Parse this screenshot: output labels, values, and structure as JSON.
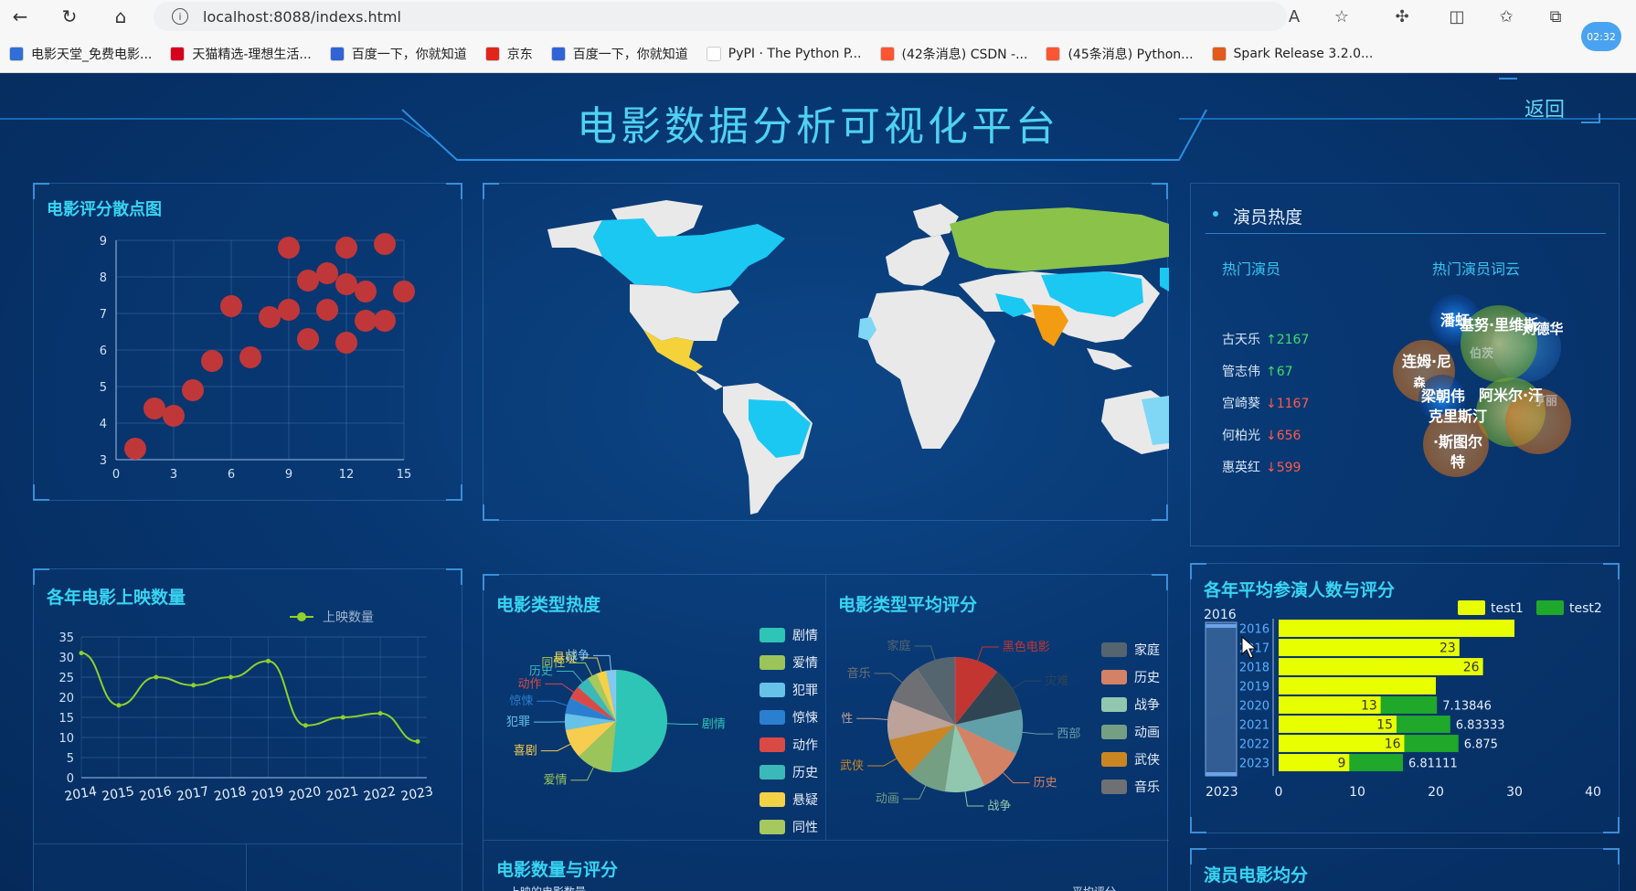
{
  "browser": {
    "url": "localhost:8088/indexs.html",
    "clock": "02:32",
    "bookmarks": [
      {
        "label": "电影天堂_免费电影...",
        "color": "#2f6fd6"
      },
      {
        "label": "天猫精选-理想生活...",
        "color": "#d6001c"
      },
      {
        "label": "百度一下，你就知道",
        "color": "#3064d6"
      },
      {
        "label": "京东",
        "color": "#e1251b"
      },
      {
        "label": "百度一下，你就知道",
        "color": "#3064d6"
      },
      {
        "label": "PyPI · The Python P...",
        "color": "#ffffff"
      },
      {
        "label": "(42条消息) CSDN -...",
        "color": "#fc5531"
      },
      {
        "label": "(45条消息) Python...",
        "color": "#fc5531"
      },
      {
        "label": "Spark Release 3.2.0...",
        "color": "#e25a1c"
      }
    ]
  },
  "header": {
    "title": "电影数据分析可视化平台",
    "back": "返回"
  },
  "scatter": {
    "title": "电影评分散点图",
    "chart_data": {
      "type": "scatter",
      "xlim": [
        0,
        15
      ],
      "ylim": [
        3,
        9
      ],
      "xticks": [
        "0",
        "3",
        "6",
        "9",
        "12",
        "15"
      ],
      "yticks": [
        "3",
        "4",
        "5",
        "6",
        "7",
        "8",
        "9"
      ],
      "points": [
        [
          1,
          3.3
        ],
        [
          2,
          4.4
        ],
        [
          3,
          4.2
        ],
        [
          4,
          4.9
        ],
        [
          5,
          5.7
        ],
        [
          6,
          7.2
        ],
        [
          7,
          5.8
        ],
        [
          8,
          6.9
        ],
        [
          9,
          8.8
        ],
        [
          9,
          7.1
        ],
        [
          10,
          7.9
        ],
        [
          10,
          6.3
        ],
        [
          11,
          8.1
        ],
        [
          11,
          7.1
        ],
        [
          12,
          8.8
        ],
        [
          12,
          7.8
        ],
        [
          12,
          6.2
        ],
        [
          13,
          7.6
        ],
        [
          13,
          6.8
        ],
        [
          14,
          6.8
        ],
        [
          14,
          8.9
        ],
        [
          15,
          7.6
        ]
      ],
      "color": "#c0373a"
    }
  },
  "map": {
    "colors": {
      "ocean": "#06386f",
      "land": "#e9e9e9",
      "cyan": "#1bc8f2",
      "green": "#8bc34a",
      "orange": "#f39c12",
      "yellow": "#f5d23a",
      "light": "#7fd7f5"
    }
  },
  "actors": {
    "title": "演员热度",
    "hot_title": "热门演员",
    "cloud_title": "热门演员词云",
    "list": [
      {
        "name": "古天乐",
        "trend": "↑2167",
        "dir": "up"
      },
      {
        "name": "管志伟",
        "trend": "↑67",
        "dir": "up"
      },
      {
        "name": "宫崎葵",
        "trend": "↓1167",
        "dir": "down"
      },
      {
        "name": "何柏光",
        "trend": "↓656",
        "dir": "down"
      },
      {
        "name": "惠英红",
        "trend": "↓599",
        "dir": "down"
      }
    ],
    "cloud_words": [
      "潘虹",
      "基努·里维斯",
      "刘德华",
      "连姆·尼",
      "森",
      "梁朝伟",
      "阿米尔·汗",
      "克里斯汀",
      "·斯图尔",
      "特",
      "伯茨",
      "亨丽"
    ]
  },
  "yearly": {
    "title": "各年电影上映数量",
    "legend": "上映数量",
    "chart_data": {
      "type": "line",
      "categories": [
        "2014",
        "2015",
        "2016",
        "2017",
        "2018",
        "2019",
        "2020",
        "2021",
        "2022",
        "2023"
      ],
      "series": [
        {
          "name": "上映数量",
          "values": [
            31,
            18,
            25,
            23,
            25,
            29,
            13,
            15,
            16,
            9
          ]
        }
      ],
      "ylim": [
        0,
        35
      ],
      "yticks": [
        "0",
        "5",
        "10",
        "15",
        "20",
        "25",
        "30",
        "35"
      ],
      "color": "#8fd12a"
    }
  },
  "genre_heat": {
    "title": "电影类型热度",
    "chart_data": {
      "type": "pie",
      "slices": [
        {
          "name": "剧情",
          "value": 50,
          "color": "#2ec4b6"
        },
        {
          "name": "爱情",
          "value": 11,
          "color": "#9bc45a"
        },
        {
          "name": "喜剧",
          "value": 9,
          "color": "#f6cd4e"
        },
        {
          "name": "犯罪",
          "value": 5,
          "color": "#66c2e8"
        },
        {
          "name": "惊悚",
          "value": 5,
          "color": "#2b7fd0"
        },
        {
          "name": "动作",
          "value": 4,
          "color": "#d94a45"
        },
        {
          "name": "历史",
          "value": 4,
          "color": "#3bb8b8"
        },
        {
          "name": "同性",
          "value": 3,
          "color": "#a6c85e"
        },
        {
          "name": "悬疑",
          "value": 3,
          "color": "#f4d248"
        },
        {
          "name": "战争",
          "value": 3,
          "color": "#84c7f0"
        }
      ],
      "legend": [
        "剧情",
        "爱情",
        "犯罪",
        "惊悚",
        "动作",
        "历史",
        "悬疑",
        "同性"
      ]
    }
  },
  "genre_score": {
    "title": "电影类型平均评分",
    "chart_data": {
      "type": "pie",
      "slices": [
        {
          "name": "黑色电影",
          "value": 9,
          "color": "#c23531"
        },
        {
          "name": "灾难",
          "value": 9,
          "color": "#2f4554"
        },
        {
          "name": "西部",
          "value": 9,
          "color": "#61a0a8"
        },
        {
          "name": "历史",
          "value": 9,
          "color": "#d48265"
        },
        {
          "name": "战争",
          "value": 8,
          "color": "#91c7ae"
        },
        {
          "name": "动画",
          "value": 8,
          "color": "#749f83"
        },
        {
          "name": "武侠",
          "value": 8,
          "color": "#ca8622"
        },
        {
          "name": "性",
          "value": 8,
          "color": "#bda29a"
        },
        {
          "name": "音乐",
          "value": 8,
          "color": "#6e7074"
        },
        {
          "name": "家庭",
          "value": 8,
          "color": "#546570"
        }
      ],
      "legend": [
        {
          "name": "家庭",
          "color": "#546570"
        },
        {
          "name": "历史",
          "color": "#d48265"
        },
        {
          "name": "战争",
          "color": "#91c7ae"
        },
        {
          "name": "动画",
          "color": "#749f83"
        },
        {
          "name": "武侠",
          "color": "#ca8622"
        },
        {
          "name": "音乐",
          "color": "#6e7074"
        }
      ]
    }
  },
  "count_score": {
    "title": "电影数量与评分",
    "left_label": "上映的电影数量",
    "right_label": "平均评分"
  },
  "avg_cast": {
    "title": "各年平均参演人数与评分",
    "legend": [
      {
        "name": "test1",
        "color": "#e8ff00"
      },
      {
        "name": "test2",
        "color": "#1fa82a"
      }
    ],
    "chart_data": {
      "type": "bar",
      "categories": [
        "2016",
        "2017",
        "2018",
        "2019",
        "2020",
        "2021",
        "2022",
        "2023"
      ],
      "series": [
        {
          "name": "test1",
          "values": [
            30,
            23,
            26,
            20,
            13,
            15,
            16,
            9
          ]
        },
        {
          "name": "test2",
          "values": [
            null,
            null,
            null,
            null,
            7.13846,
            6.83333,
            6.875,
            6.81111
          ]
        }
      ],
      "xlim": [
        0,
        40
      ],
      "xticks": [
        "0",
        "10",
        "20",
        "30",
        "40"
      ],
      "labels_test1": [
        "",
        "23",
        "26",
        "",
        "13",
        "15",
        "16",
        "9"
      ],
      "labels_test2": [
        "",
        "",
        "",
        "",
        "7.13846",
        "6.83333",
        "6.875",
        "6.81111"
      ],
      "slider_top": "2016",
      "slider_bottom": "2023"
    }
  },
  "actor_avg": {
    "title": "演员电影均分"
  }
}
